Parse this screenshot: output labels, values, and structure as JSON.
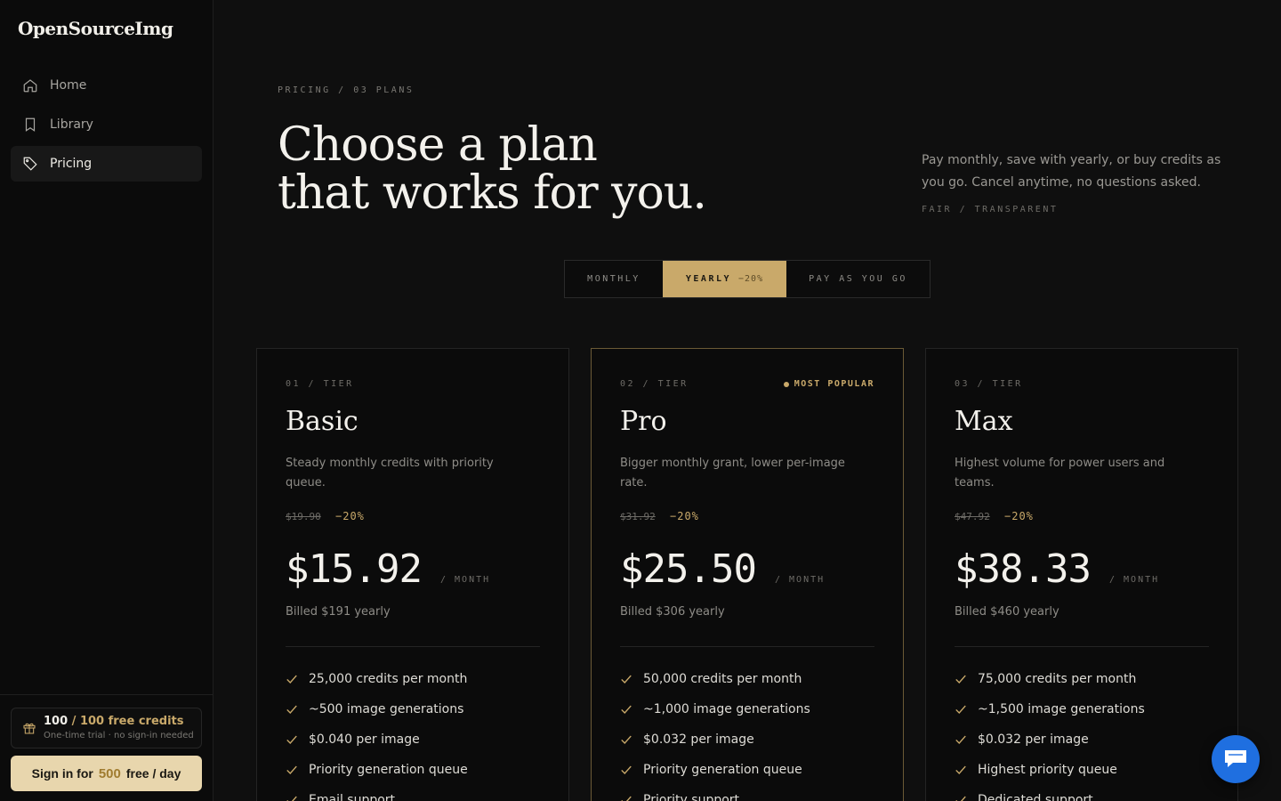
{
  "brand": "OpenSourceImg",
  "nav": [
    {
      "label": "Home",
      "icon": "home-icon"
    },
    {
      "label": "Library",
      "icon": "bookmark-icon"
    },
    {
      "label": "Pricing",
      "icon": "tag-icon",
      "active": true
    }
  ],
  "credits": {
    "current": "100",
    "total": "/ 100 free credits",
    "sub": "One-time trial · no sign-in needed"
  },
  "signin": {
    "prefix": "Sign in for",
    "amount": "500",
    "suffix": "free / day"
  },
  "header": {
    "eyebrow": "PRICING / 03 PLANS",
    "headline_1": "Choose a plan",
    "headline_2": "that works for you.",
    "lede": "Pay monthly, save with yearly, or buy credits as you go. Cancel anytime, no questions asked.",
    "lede_tag": "FAIR / TRANSPARENT"
  },
  "toggle": {
    "monthly": "MONTHLY",
    "yearly": "YEARLY",
    "yearly_discount": "−20%",
    "payg": "PAY AS YOU GO",
    "selected": "yearly"
  },
  "plans": [
    {
      "tier": "01 / TIER",
      "name": "Basic",
      "desc": "Steady monthly credits with priority queue.",
      "orig": "$19.90",
      "off": "−20%",
      "price": "$15.92",
      "per": "/ MONTH",
      "billed": "Billed $191 yearly",
      "features": [
        "25,000 credits per month",
        "~500 image generations",
        "$0.040 per image",
        "Priority generation queue",
        "Email support"
      ]
    },
    {
      "tier": "02 / TIER",
      "popular": "MOST POPULAR",
      "name": "Pro",
      "desc": "Bigger monthly grant, lower per-image rate.",
      "orig": "$31.92",
      "off": "−20%",
      "price": "$25.50",
      "per": "/ MONTH",
      "billed": "Billed $306 yearly",
      "features": [
        "50,000 credits per month",
        "~1,000 image generations",
        "$0.032 per image",
        "Priority generation queue",
        "Priority support"
      ]
    },
    {
      "tier": "03 / TIER",
      "name": "Max",
      "desc": "Highest volume for power users and teams.",
      "orig": "$47.92",
      "off": "−20%",
      "price": "$38.33",
      "per": "/ MONTH",
      "billed": "Billed $460 yearly",
      "features": [
        "75,000 credits per month",
        "~1,500 image generations",
        "$0.032 per image",
        "Highest priority queue",
        "Dedicated support"
      ]
    }
  ],
  "colors": {
    "accent": "#c9a96a",
    "background": "#0f0f0f",
    "chat": "#1f6fe0"
  },
  "chat_icon": "chat-bubble-icon"
}
